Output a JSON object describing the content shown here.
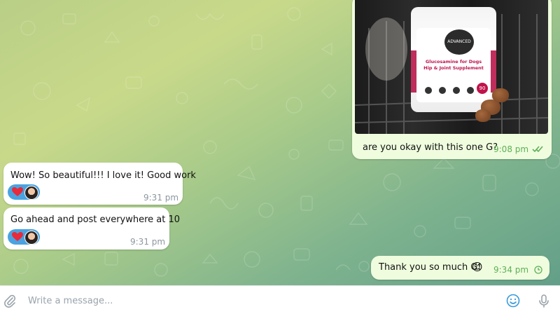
{
  "image": {
    "overlay_text": "",
    "caption_visible": true
  },
  "messages": [
    {
      "id": "m1",
      "direction": "outgoing",
      "type": "photo",
      "text": "are you okay with this one G?",
      "time": "9:08 pm",
      "status": "read",
      "product": {
        "brand": "ADVANCED PUP",
        "title_line1": "Glucosamine for Dogs",
        "title_line2": "Hip & Joint Supplement",
        "count": "90"
      }
    },
    {
      "id": "m2",
      "direction": "incoming",
      "type": "text",
      "text": "Wow! So beautiful!!! I love it!  Good work",
      "time": "9:31 pm",
      "reactions": [
        "red-heart"
      ]
    },
    {
      "id": "m3",
      "direction": "incoming",
      "type": "text",
      "text": "Go ahead and post everywhere at 10",
      "time": "9:31 pm",
      "reactions": [
        "red-heart"
      ]
    },
    {
      "id": "m4",
      "direction": "outgoing",
      "type": "text",
      "text": "Thank you so much G!",
      "emoji": "😊",
      "time": "9:34 pm",
      "status": "pending"
    }
  ],
  "composer": {
    "placeholder": "Write a message...",
    "icons": [
      "paperclip-icon",
      "emoji-icon",
      "microphone-icon"
    ]
  },
  "colors": {
    "outgoing_bubble": "#effdde",
    "incoming_bubble": "#ffffff",
    "time_outgoing": "#5fae59",
    "time_incoming": "#8c97a0",
    "reaction_pill": "#4aa3e0",
    "accent": "#3a9bd9"
  }
}
